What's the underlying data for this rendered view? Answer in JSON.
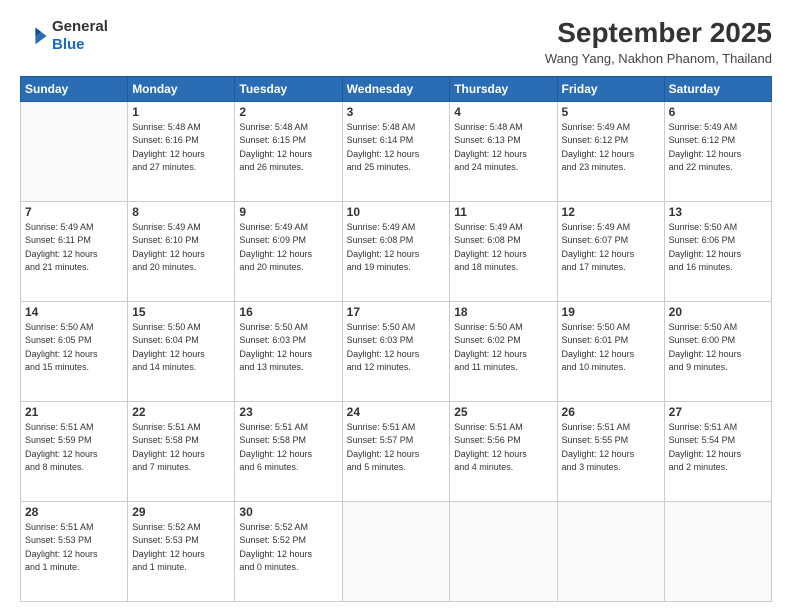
{
  "header": {
    "logo": {
      "line1": "General",
      "line2": "Blue"
    },
    "title": "September 2025",
    "location": "Wang Yang, Nakhon Phanom, Thailand"
  },
  "calendar": {
    "days_of_week": [
      "Sunday",
      "Monday",
      "Tuesday",
      "Wednesday",
      "Thursday",
      "Friday",
      "Saturday"
    ],
    "weeks": [
      [
        {
          "day": "",
          "info": ""
        },
        {
          "day": "1",
          "info": "Sunrise: 5:48 AM\nSunset: 6:16 PM\nDaylight: 12 hours\nand 27 minutes."
        },
        {
          "day": "2",
          "info": "Sunrise: 5:48 AM\nSunset: 6:15 PM\nDaylight: 12 hours\nand 26 minutes."
        },
        {
          "day": "3",
          "info": "Sunrise: 5:48 AM\nSunset: 6:14 PM\nDaylight: 12 hours\nand 25 minutes."
        },
        {
          "day": "4",
          "info": "Sunrise: 5:48 AM\nSunset: 6:13 PM\nDaylight: 12 hours\nand 24 minutes."
        },
        {
          "day": "5",
          "info": "Sunrise: 5:49 AM\nSunset: 6:12 PM\nDaylight: 12 hours\nand 23 minutes."
        },
        {
          "day": "6",
          "info": "Sunrise: 5:49 AM\nSunset: 6:12 PM\nDaylight: 12 hours\nand 22 minutes."
        }
      ],
      [
        {
          "day": "7",
          "info": "Sunrise: 5:49 AM\nSunset: 6:11 PM\nDaylight: 12 hours\nand 21 minutes."
        },
        {
          "day": "8",
          "info": "Sunrise: 5:49 AM\nSunset: 6:10 PM\nDaylight: 12 hours\nand 20 minutes."
        },
        {
          "day": "9",
          "info": "Sunrise: 5:49 AM\nSunset: 6:09 PM\nDaylight: 12 hours\nand 20 minutes."
        },
        {
          "day": "10",
          "info": "Sunrise: 5:49 AM\nSunset: 6:08 PM\nDaylight: 12 hours\nand 19 minutes."
        },
        {
          "day": "11",
          "info": "Sunrise: 5:49 AM\nSunset: 6:08 PM\nDaylight: 12 hours\nand 18 minutes."
        },
        {
          "day": "12",
          "info": "Sunrise: 5:49 AM\nSunset: 6:07 PM\nDaylight: 12 hours\nand 17 minutes."
        },
        {
          "day": "13",
          "info": "Sunrise: 5:50 AM\nSunset: 6:06 PM\nDaylight: 12 hours\nand 16 minutes."
        }
      ],
      [
        {
          "day": "14",
          "info": "Sunrise: 5:50 AM\nSunset: 6:05 PM\nDaylight: 12 hours\nand 15 minutes."
        },
        {
          "day": "15",
          "info": "Sunrise: 5:50 AM\nSunset: 6:04 PM\nDaylight: 12 hours\nand 14 minutes."
        },
        {
          "day": "16",
          "info": "Sunrise: 5:50 AM\nSunset: 6:03 PM\nDaylight: 12 hours\nand 13 minutes."
        },
        {
          "day": "17",
          "info": "Sunrise: 5:50 AM\nSunset: 6:03 PM\nDaylight: 12 hours\nand 12 minutes."
        },
        {
          "day": "18",
          "info": "Sunrise: 5:50 AM\nSunset: 6:02 PM\nDaylight: 12 hours\nand 11 minutes."
        },
        {
          "day": "19",
          "info": "Sunrise: 5:50 AM\nSunset: 6:01 PM\nDaylight: 12 hours\nand 10 minutes."
        },
        {
          "day": "20",
          "info": "Sunrise: 5:50 AM\nSunset: 6:00 PM\nDaylight: 12 hours\nand 9 minutes."
        }
      ],
      [
        {
          "day": "21",
          "info": "Sunrise: 5:51 AM\nSunset: 5:59 PM\nDaylight: 12 hours\nand 8 minutes."
        },
        {
          "day": "22",
          "info": "Sunrise: 5:51 AM\nSunset: 5:58 PM\nDaylight: 12 hours\nand 7 minutes."
        },
        {
          "day": "23",
          "info": "Sunrise: 5:51 AM\nSunset: 5:58 PM\nDaylight: 12 hours\nand 6 minutes."
        },
        {
          "day": "24",
          "info": "Sunrise: 5:51 AM\nSunset: 5:57 PM\nDaylight: 12 hours\nand 5 minutes."
        },
        {
          "day": "25",
          "info": "Sunrise: 5:51 AM\nSunset: 5:56 PM\nDaylight: 12 hours\nand 4 minutes."
        },
        {
          "day": "26",
          "info": "Sunrise: 5:51 AM\nSunset: 5:55 PM\nDaylight: 12 hours\nand 3 minutes."
        },
        {
          "day": "27",
          "info": "Sunrise: 5:51 AM\nSunset: 5:54 PM\nDaylight: 12 hours\nand 2 minutes."
        }
      ],
      [
        {
          "day": "28",
          "info": "Sunrise: 5:51 AM\nSunset: 5:53 PM\nDaylight: 12 hours\nand 1 minute."
        },
        {
          "day": "29",
          "info": "Sunrise: 5:52 AM\nSunset: 5:53 PM\nDaylight: 12 hours\nand 1 minute."
        },
        {
          "day": "30",
          "info": "Sunrise: 5:52 AM\nSunset: 5:52 PM\nDaylight: 12 hours\nand 0 minutes."
        },
        {
          "day": "",
          "info": ""
        },
        {
          "day": "",
          "info": ""
        },
        {
          "day": "",
          "info": ""
        },
        {
          "day": "",
          "info": ""
        }
      ]
    ]
  }
}
